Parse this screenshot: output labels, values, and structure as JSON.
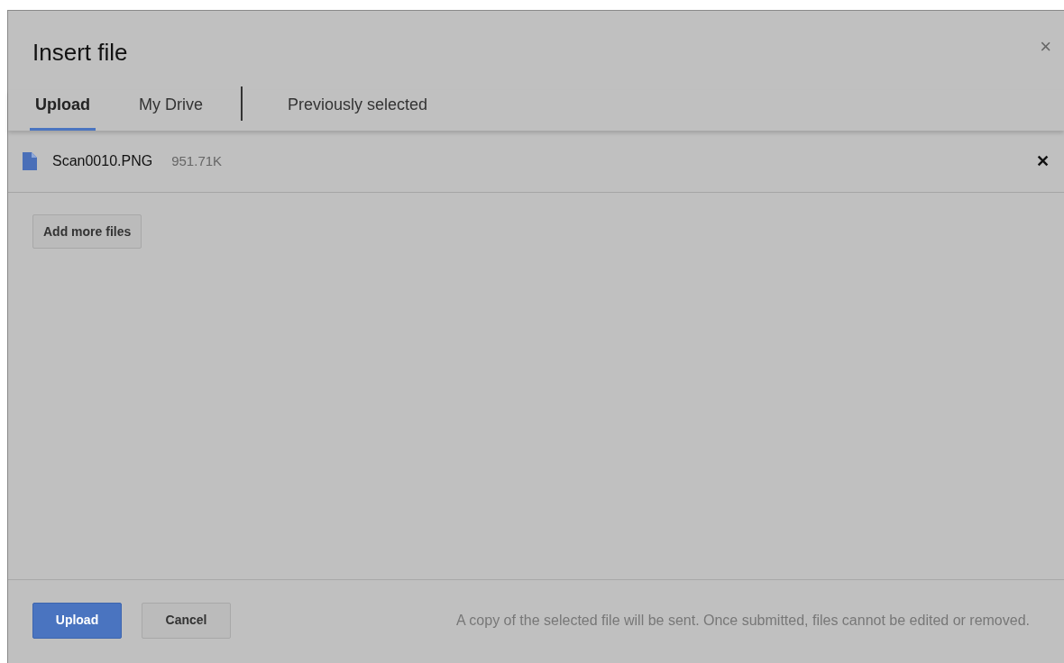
{
  "dialog": {
    "title": "Insert file",
    "close": "×"
  },
  "tabs": [
    {
      "kind": "tab",
      "label": "Upload",
      "selected": true
    },
    {
      "kind": "tab",
      "label": "My Drive",
      "selected": false
    },
    {
      "kind": "divider"
    },
    {
      "kind": "tab",
      "label": "Previously selected",
      "selected": false
    }
  ],
  "files": [
    {
      "name": "Scan0010.PNG",
      "size": "951.71K",
      "remove": "✕"
    }
  ],
  "add_button": "Add more files",
  "footer": {
    "primary": "Upload",
    "secondary": "Cancel",
    "note": "A copy of the selected file will be sent. Once submitted, files cannot be edited or removed."
  }
}
